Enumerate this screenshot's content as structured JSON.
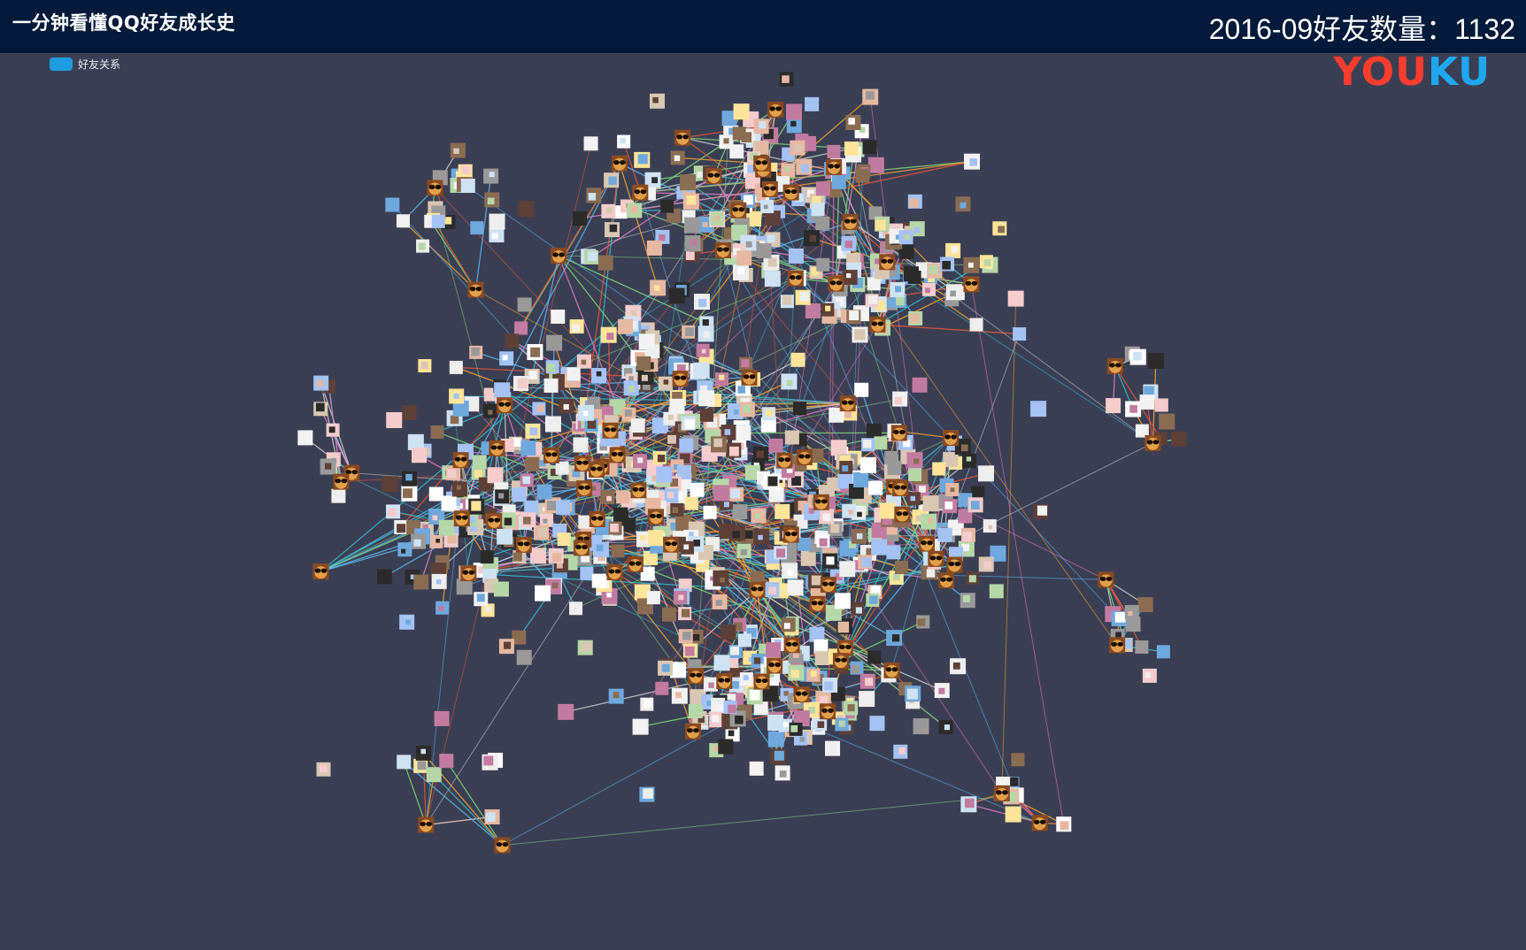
{
  "header": {
    "title": "一分钟看懂QQ好友成长史",
    "counter": "2016-09好友数量：1132"
  },
  "legend": {
    "items": [
      {
        "label": "好友关系",
        "color": "#1e9ce0"
      }
    ]
  },
  "watermark": {
    "text_you": "YOU",
    "text_ku": "KU"
  },
  "graph": {
    "background": "#3b3f54",
    "edge_colors": [
      "#e0553a",
      "#f0a030",
      "#38b8c8",
      "#5ab4e8",
      "#7fd37a",
      "#e07ac0",
      "#c8c8c8"
    ],
    "hub_icon": "sunglasses-emoji-icon",
    "node_palette": [
      "#f2f2f2",
      "#ffffff",
      "#d9c7b3",
      "#8a6c52",
      "#2b2b2b",
      "#6fa8dc",
      "#e6b8a2",
      "#a4c2f4",
      "#cfe2f3",
      "#f4cccc",
      "#b6d7a8",
      "#ffe599",
      "#999999",
      "#c27ba0",
      "#5d4037",
      "#eeeeee"
    ]
  }
}
